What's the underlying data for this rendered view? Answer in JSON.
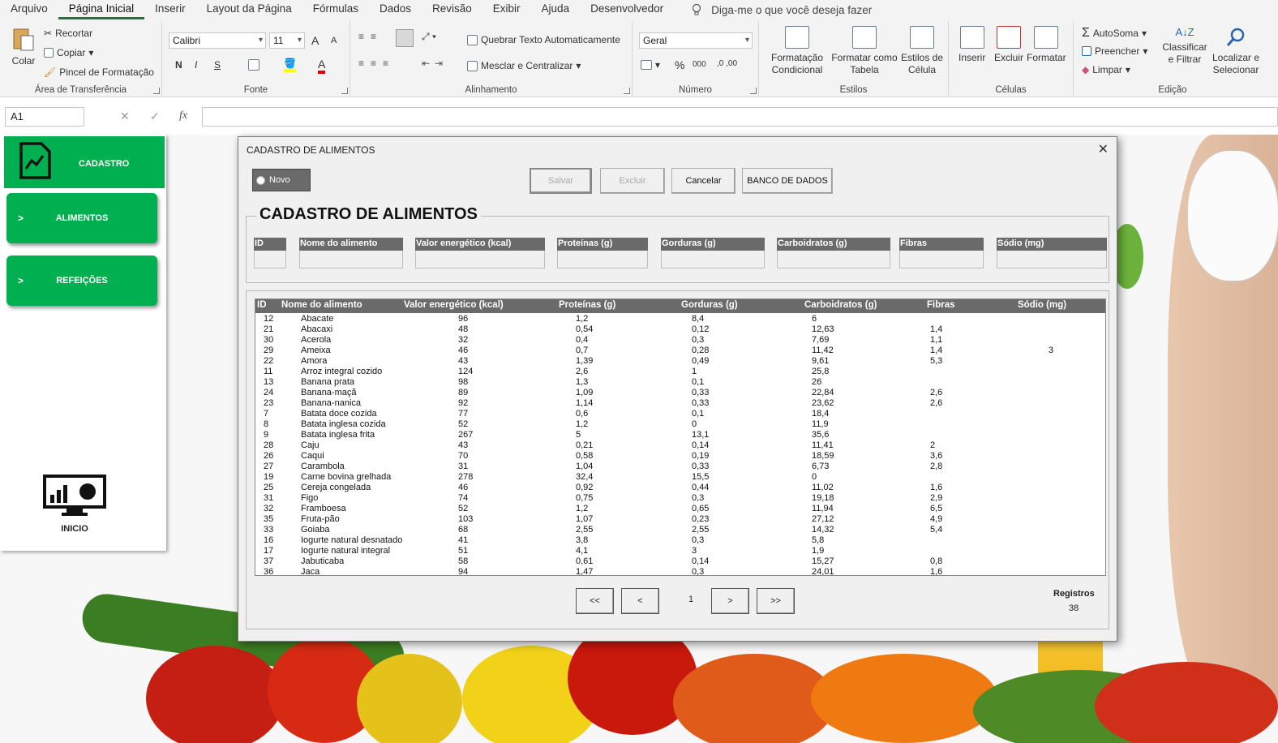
{
  "menu": {
    "tabs": [
      "Arquivo",
      "Página Inicial",
      "Inserir",
      "Layout da Página",
      "Fórmulas",
      "Dados",
      "Revisão",
      "Exibir",
      "Ajuda",
      "Desenvolvedor"
    ],
    "tell_me": "Diga-me o que você deseja fazer"
  },
  "ribbon": {
    "clipboard": {
      "paste": "Colar",
      "cut": "Recortar",
      "copy": "Copiar",
      "format_painter": "Pincel de Formatação",
      "label": "Área de Transferência"
    },
    "font": {
      "name": "Calibri",
      "size": "11",
      "bold": "N",
      "italic": "I",
      "underline": "S",
      "grow": "A",
      "shrink": "A",
      "color_letter": "A",
      "label": "Fonte"
    },
    "alignment": {
      "wrap": "Quebrar Texto Automaticamente",
      "merge": "Mesclar e Centralizar",
      "label": "Alinhamento"
    },
    "number": {
      "format": "Geral",
      "percent": "%",
      "thousands": "000",
      "label": "Número"
    },
    "styles": {
      "conditional": "Formatação Condicional",
      "as_table": "Formatar como Tabela",
      "cell_styles": "Estilos de Célula",
      "label": "Estilos"
    },
    "cells": {
      "insert": "Inserir",
      "delete": "Excluir",
      "format": "Formatar",
      "label": "Células"
    },
    "editing": {
      "autosum": "AutoSoma",
      "fill": "Preencher",
      "clear": "Limpar",
      "sort": "Classificar e Filtrar",
      "find": "Localizar e Selecionar",
      "label": "Edição"
    }
  },
  "formula_bar": {
    "name_box": "A1",
    "fx": "fx",
    "cancel": "✕",
    "enter": "✓"
  },
  "sidebar": {
    "header": "CADASTRO",
    "items": [
      {
        "label": "ALIMENTOS",
        "arrow": ">"
      },
      {
        "label": "REFEIÇÕES",
        "arrow": ">"
      }
    ],
    "home": "INICIO"
  },
  "dialog": {
    "title": "CADASTRO DE ALIMENTOS",
    "close": "✕",
    "novo": "Novo",
    "buttons": {
      "save": "Salvar",
      "delete": "Excluir",
      "cancel": "Cancelar",
      "database": "BANCO DE DADOS"
    },
    "form_title": "CADASTRO DE ALIMENTOS",
    "fields": [
      "ID",
      "Nome do alimento",
      "Valor energético (kcal)",
      "Proteínas (g)",
      "Gorduras (g)",
      "Carboidratos (g)",
      "Fibras",
      "Sódio (mg)"
    ],
    "list_columns": [
      "ID",
      "Nome do alimento",
      "Valor energético (kcal)",
      "Proteínas (g)",
      "Gorduras (g)",
      "Carboidratos (g)",
      "Fibras",
      "Sódio (mg)"
    ],
    "rows": [
      [
        "12",
        "Abacate",
        "96",
        "1,2",
        "8,4",
        "6",
        "",
        ""
      ],
      [
        "21",
        "Abacaxi",
        "48",
        "0,54",
        "0,12",
        "12,63",
        "1,4",
        ""
      ],
      [
        "30",
        "Acerola",
        "32",
        "0,4",
        "0,3",
        "7,69",
        "1,1",
        ""
      ],
      [
        "29",
        "Ameixa",
        "46",
        "0,7",
        "0,28",
        "11,42",
        "1,4",
        "3"
      ],
      [
        "22",
        "Amora",
        "43",
        "1,39",
        "0,49",
        "9,61",
        "5,3",
        ""
      ],
      [
        "11",
        "Arroz integral cozido",
        "124",
        "2,6",
        "1",
        "25,8",
        "",
        ""
      ],
      [
        "13",
        "Banana prata",
        "98",
        "1,3",
        "0,1",
        "26",
        "",
        ""
      ],
      [
        "24",
        "Banana-maçã",
        "89",
        "1,09",
        "0,33",
        "22,84",
        "2,6",
        ""
      ],
      [
        "23",
        "Banana-nanica",
        "92",
        "1,14",
        "0,33",
        "23,62",
        "2,6",
        ""
      ],
      [
        "7",
        "Batata doce cozida",
        "77",
        "0,6",
        "0,1",
        "18,4",
        "",
        ""
      ],
      [
        "8",
        "Batata inglesa cozida",
        "52",
        "1,2",
        "0",
        "11,9",
        "",
        ""
      ],
      [
        "9",
        "Batata inglesa frita",
        "267",
        "5",
        "13,1",
        "35,6",
        "",
        ""
      ],
      [
        "28",
        "Caju",
        "43",
        "0,21",
        "0,14",
        "11,41",
        "2",
        ""
      ],
      [
        "26",
        "Caqui",
        "70",
        "0,58",
        "0,19",
        "18,59",
        "3,6",
        ""
      ],
      [
        "27",
        "Carambola",
        "31",
        "1,04",
        "0,33",
        "6,73",
        "2,8",
        ""
      ],
      [
        "19",
        "Carne bovina grelhada",
        "278",
        "32,4",
        "15,5",
        "0",
        "",
        ""
      ],
      [
        "25",
        "Cereja congelada",
        "46",
        "0,92",
        "0,44",
        "11,02",
        "1,6",
        ""
      ],
      [
        "31",
        "Figo",
        "74",
        "0,75",
        "0,3",
        "19,18",
        "2,9",
        ""
      ],
      [
        "32",
        "Framboesa",
        "52",
        "1,2",
        "0,65",
        "11,94",
        "6,5",
        ""
      ],
      [
        "35",
        "Fruta-pão",
        "103",
        "1,07",
        "0,23",
        "27,12",
        "4,9",
        ""
      ],
      [
        "33",
        "Goiaba",
        "68",
        "2,55",
        "2,55",
        "14,32",
        "5,4",
        ""
      ],
      [
        "16",
        "Iogurte natural desnatado",
        "41",
        "3,8",
        "0,3",
        "5,8",
        "",
        ""
      ],
      [
        "17",
        "Iogurte natural integral",
        "51",
        "4,1",
        "3",
        "1,9",
        "",
        ""
      ],
      [
        "37",
        "Jabuticaba",
        "58",
        "0,61",
        "0,14",
        "15,27",
        "0,8",
        ""
      ],
      [
        "36",
        "Jaca",
        "94",
        "1,47",
        "0,3",
        "24,01",
        "1,6",
        ""
      ]
    ],
    "pagination": {
      "first": "<<",
      "prev": "<",
      "page": "1",
      "next": ">",
      "last": ">>"
    },
    "records": {
      "label": "Registros",
      "count": "38"
    }
  },
  "colors": {
    "excel_green": "#217346",
    "accent_green": "#00b050",
    "header_gray": "#6a6a6a"
  },
  "icons": [
    "lightbulb-icon",
    "paste-icon",
    "scissors-icon",
    "copy-icon",
    "format-painter-icon",
    "chart-document-icon",
    "dashboard-monitor-icon"
  ]
}
